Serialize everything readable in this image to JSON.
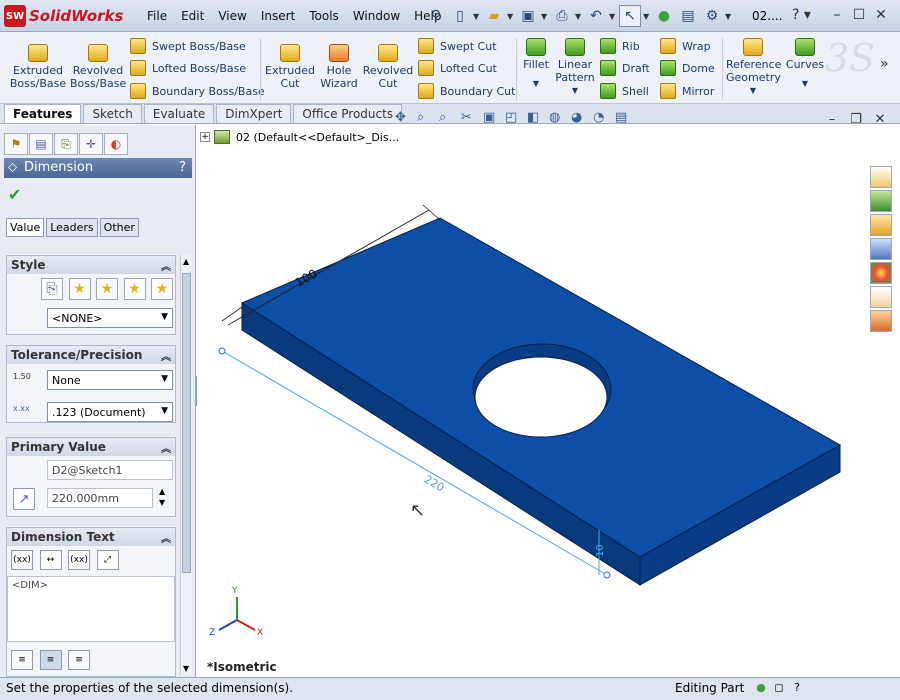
{
  "app": {
    "logo_text": "SolidWorks",
    "logo_mark": "SW",
    "doc_title": "02...."
  },
  "menu": [
    "File",
    "Edit",
    "View",
    "Insert",
    "Tools",
    "Window",
    "Help"
  ],
  "cmd": {
    "extruded_boss": "Extruded\nBoss/Base",
    "revolved_boss": "Revolved\nBoss/Base",
    "swept_boss": "Swept Boss/Base",
    "lofted_boss": "Lofted Boss/Base",
    "boundary_boss": "Boundary Boss/Base",
    "extruded_cut": "Extruded\nCut",
    "hole_wizard": "Hole\nWizard",
    "revolved_cut": "Revolved\nCut",
    "swept_cut": "Swept Cut",
    "lofted_cut": "Lofted Cut",
    "boundary_cut": "Boundary Cut",
    "fillet": "Fillet",
    "linear_pattern": "Linear\nPattern",
    "rib": "Rib",
    "draft": "Draft",
    "shell": "Shell",
    "wrap": "Wrap",
    "dome": "Dome",
    "mirror": "Mirror",
    "reference_geometry": "Reference\nGeometry",
    "curves": "Curves"
  },
  "tabs": [
    "Features",
    "Sketch",
    "Evaluate",
    "DimXpert",
    "Office Products"
  ],
  "pm": {
    "title": "Dimension",
    "subtabs": [
      "Value",
      "Leaders",
      "Other"
    ],
    "style": {
      "header": "Style",
      "select": "<NONE>"
    },
    "tolerance": {
      "header": "Tolerance/Precision",
      "tol_select": "None",
      "prec_select": ".123 (Document)",
      "tol_icon": "1.50",
      "prec_icon": "x.xx"
    },
    "primary": {
      "header": "Primary Value",
      "name": "D2@Sketch1",
      "value": "220.000mm"
    },
    "dimtext": {
      "header": "Dimension Text",
      "text": "<DIM>"
    }
  },
  "viewport": {
    "tree_label": "02  (Default<<Default>_Dis...",
    "view_name": "*Isometric",
    "dim_100": "100",
    "dim_220": "220",
    "dim_10": "10",
    "axis_x": "X",
    "axis_y": "Y",
    "axis_z": "Z"
  },
  "status": {
    "message": "Set the properties of the selected dimension(s).",
    "mode": "Editing Part"
  },
  "colors": {
    "part": "#0b4596",
    "part_top": "#0d4ea6",
    "part_side": "#0a3a80",
    "part_front": "#083372"
  }
}
